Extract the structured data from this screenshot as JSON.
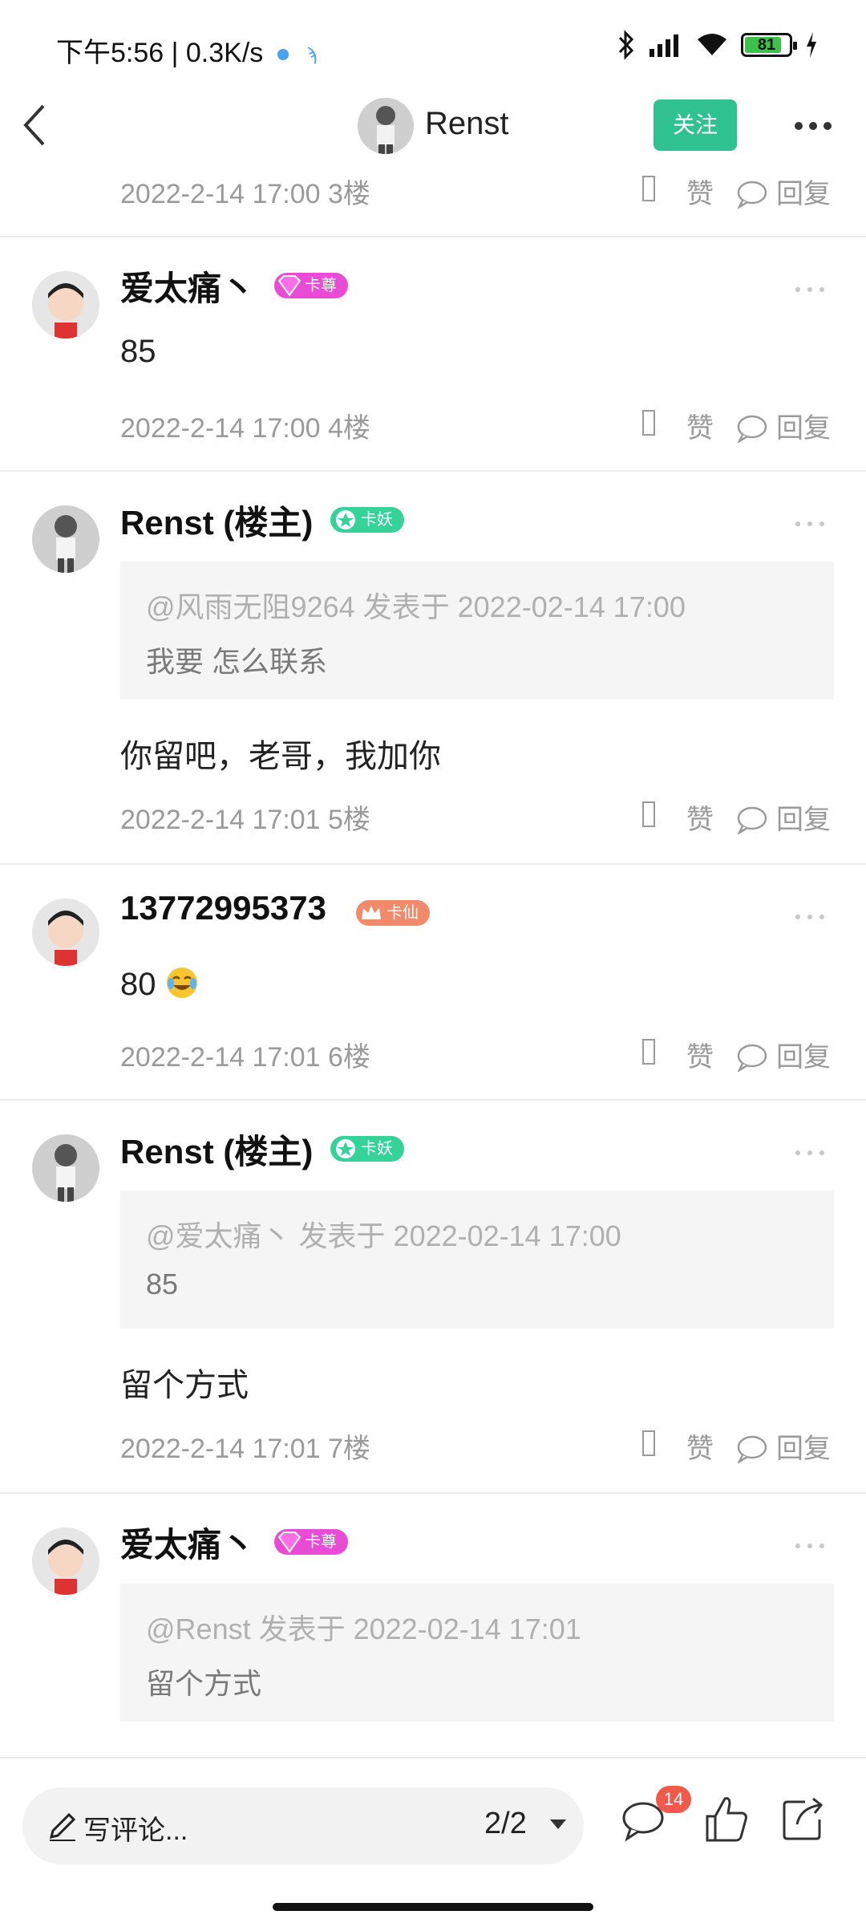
{
  "status_bar": {
    "time_speed": "下午5:56 | 0.3K/s",
    "battery_level": "81",
    "battery_fraction": 0.81
  },
  "header": {
    "title": "Renst",
    "follow_label": "关注"
  },
  "posts": [
    {
      "meta": "2022-2-14 17:00  3楼",
      "like": "赞",
      "reply": "回复"
    },
    {
      "username": "爱太痛丶",
      "badge": "卡尊",
      "content": "85",
      "meta": "2022-2-14 17:00  4楼",
      "like": "赞",
      "reply": "回复"
    },
    {
      "username": "Renst (楼主)",
      "badge": "卡妖",
      "quote_meta": "@风雨无阻9264 发表于 2022-02-14 17:00",
      "quote_text": "我要  怎么联系",
      "content": "你留吧，老哥，我加你",
      "meta": "2022-2-14 17:01  5楼",
      "like": "赞",
      "reply": "回复"
    },
    {
      "username": "13772995373",
      "badge": "卡仙",
      "content": "80",
      "meta": "2022-2-14 17:01  6楼",
      "like": "赞",
      "reply": "回复"
    },
    {
      "username": "Renst (楼主)",
      "badge": "卡妖",
      "quote_meta": "@爱太痛丶 发表于 2022-02-14 17:00",
      "quote_text": "85",
      "content": "留个方式",
      "meta": "2022-2-14 17:01  7楼",
      "like": "赞",
      "reply": "回复"
    },
    {
      "username": "爱太痛丶",
      "badge": "卡尊",
      "quote_meta": "@Renst 发表于 2022-02-14 17:01",
      "quote_text": "留个方式"
    }
  ],
  "bottom_bar": {
    "comment_placeholder": "写评论...",
    "page_indicator": "2/2",
    "comment_count": "14"
  },
  "colors": {
    "accent": "#2fc18f",
    "badge_zun": "#e94bd6",
    "badge_yao": "#35d39a",
    "badge_xian": "#f08a6a",
    "notification": "#f15a4a"
  }
}
